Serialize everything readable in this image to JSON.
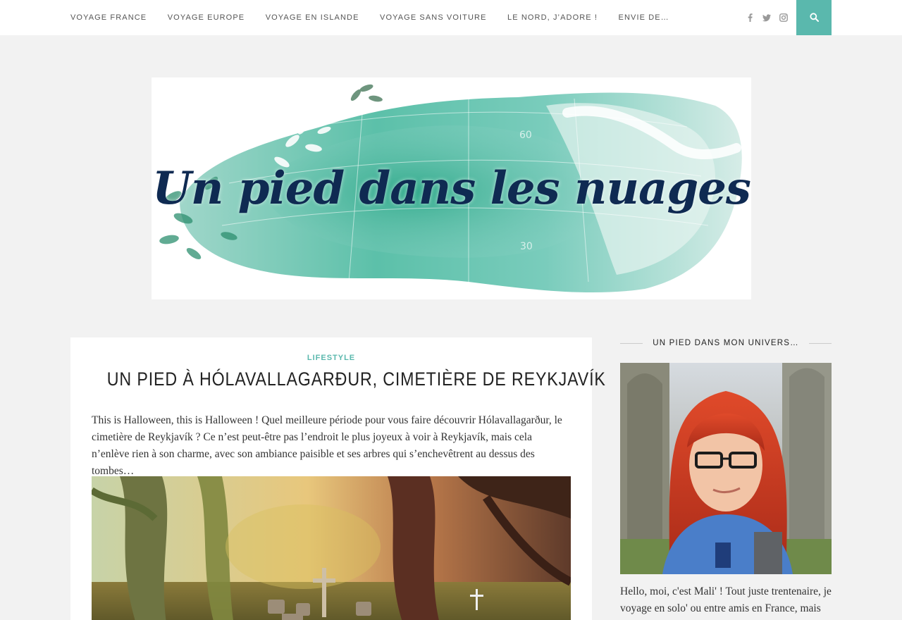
{
  "nav": {
    "items": [
      {
        "label": "VOYAGE FRANCE"
      },
      {
        "label": "VOYAGE EUROPE"
      },
      {
        "label": "VOYAGE EN ISLANDE"
      },
      {
        "label": "VOYAGE SANS VOITURE"
      },
      {
        "label": "LE NORD, J’ADORE !"
      },
      {
        "label": "ENVIE DE…"
      }
    ],
    "social_icons": [
      "facebook-icon",
      "twitter-icon",
      "instagram-icon"
    ],
    "search_icon": "search-icon"
  },
  "banner": {
    "title": "Un pied dans les nuages"
  },
  "post": {
    "category": "LIFESTYLE",
    "title": "UN PIED À HÓLAVALLAGARÐUR, CIMETIÈRE DE REYKJAVÍK",
    "excerpt": "This is Halloween, this is Halloween ! Quel meilleure période pour vous faire découvrir Hólavallagarður, le cimetière de Reykjavík ? Ce n’est peut-être pas l’endroit le plus joyeux à voir à Reykjavík, mais cela n’enlève rien à son charme, avec son ambiance paisible et ses arbres qui s’enchevêtrent au dessus des tombes…"
  },
  "sidebar": {
    "widget_title": "UN PIED DANS MON UNIVERS…",
    "bio": "Hello, moi, c'est Mali' ! Tout juste trentenaire, je voyage en solo' ou entre amis en France, mais"
  },
  "colors": {
    "accent": "#5ab8ad",
    "page_bg": "#f2f2f2",
    "banner_title": "#0f2a52"
  }
}
